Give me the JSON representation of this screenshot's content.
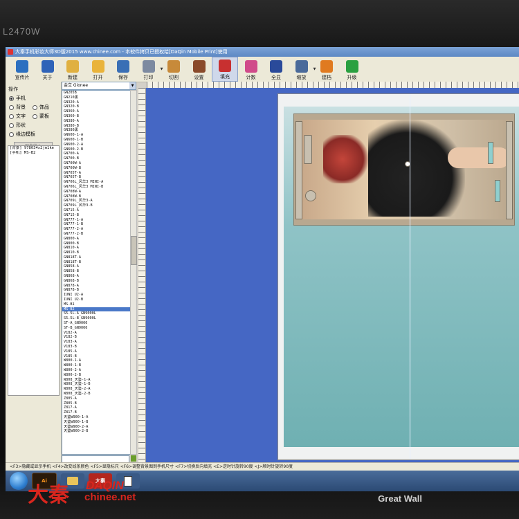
{
  "monitor": {
    "model": "L2470W",
    "brand": "Great Wall"
  },
  "window": {
    "title": "大秦手机彩妆大师3D版2015 www.chinee.com - 本软件拷贝已授权给[DaQin Mobile Print]使用"
  },
  "toolbar": {
    "items": [
      {
        "label": "宣传片",
        "icon": "media-icon",
        "color": "#2b6fc0"
      },
      {
        "label": "关于",
        "icon": "info-icon",
        "color": "#2f63b8"
      },
      {
        "label": "新建",
        "icon": "new-doc-icon",
        "color": "#e0b040"
      },
      {
        "label": "打开",
        "icon": "open-folder-icon",
        "color": "#e9b33a"
      },
      {
        "label": "保存",
        "icon": "save-icon",
        "color": "#3a6fb5"
      },
      {
        "label": "打印",
        "icon": "printer-icon",
        "color": "#7d8aa0"
      },
      {
        "label": "切割",
        "icon": "cut-icon",
        "color": "#c78a3a"
      },
      {
        "label": "设置",
        "icon": "tools-icon",
        "color": "#8a4a2a"
      },
      {
        "label": "填充",
        "icon": "fill-icon",
        "color": "#c83030"
      },
      {
        "label": "计数",
        "icon": "chart-icon",
        "color": "#d04a8a"
      },
      {
        "label": "全显",
        "icon": "fullscreen-icon",
        "color": "#2a4a9a"
      },
      {
        "label": "缩放",
        "icon": "zoom-icon",
        "color": "#4a6a9a"
      },
      {
        "label": "建档",
        "icon": "archive-icon",
        "color": "#e07a20"
      },
      {
        "label": "升级",
        "icon": "upgrade-icon",
        "color": "#2aa040"
      }
    ]
  },
  "left_panel": {
    "group_title": "操作",
    "radios": [
      {
        "label": "手机",
        "checked": true
      },
      {
        "label": "背景",
        "checked": false,
        "pair_label": "饰品"
      },
      {
        "label": "文字",
        "checked": false,
        "pair_label": "蒙板"
      },
      {
        "label": "形状",
        "checked": false
      },
      {
        "label": "缘边模板",
        "checked": false
      }
    ],
    "import_button": "图像输入",
    "layers": [
      "[背景] 978034x2jm1ke",
      "[手机] MS-B2"
    ]
  },
  "model_list": {
    "combo_value": "金立 Gionee",
    "selected_index": 49,
    "items": [
      "GN205B",
      "GN210黑",
      "GN320-A",
      "GN320-B",
      "GN360-A",
      "GN360-B",
      "GN380-A",
      "GN380-B",
      "GN380黑",
      "GN600-1-A",
      "GN600-1-B",
      "GN600-2-A",
      "GN600-2-B",
      "GN700-A",
      "GN700-B",
      "GN700W-A",
      "GN700W-B",
      "GN705T-A",
      "GN705T-B",
      "GN706L_风华3 MINI-A",
      "GN706L_风华3 MINI-B",
      "GN708W-A",
      "GN708W-B",
      "GN709L_风华3-A",
      "GN709L_风华3-B",
      "GN715-A",
      "GN715-B",
      "GN777-1-A",
      "GN777-1-B",
      "GN777-2-A",
      "GN777-2-B",
      "GN800-A",
      "GN800-B",
      "GN810-A",
      "GN810-B",
      "GN818T-A",
      "GN818T-B",
      "GN858-A",
      "GN858-B",
      "GN868-A",
      "GN868-B",
      "GN878-A",
      "GN878-B",
      "IUNI U2-A",
      "IUNI U2-B",
      "MS-B1",
      "MS-B2",
      "S5.5L-A_GN9000L",
      "S5.5L-B_GN9000L",
      "ST-A_GN9006",
      "ST-B_GN9006",
      "V182-A",
      "V182-B",
      "V183-A",
      "V183-B",
      "V185-A",
      "V185-B",
      "W800-1-A",
      "W800-1-B",
      "W800-2-A",
      "W800-2-B",
      "W808_天鉴-1-A",
      "W808_天鉴-1-B",
      "W808_天鉴-2-A",
      "W808_天鉴-2-B",
      "Z805-A",
      "Z805-B",
      "Z817-A",
      "Z817-B",
      "天鉴W900-1-A",
      "天鉴W900-1-B",
      "天鉴W900-2-A",
      "天鉴W900-2-B"
    ]
  },
  "status_bar": "<F3>隐藏或显示手机 <F4>改变线条颜色 <F5>显隐标尺 <F6>调整背景图到手机尺寸 <F7>切换反向填充 <E>逆时针旋转90度 <J>顺时针旋转90度",
  "taskbar": {
    "app_label": "大秦",
    "ai_label": "Ai"
  },
  "watermark": {
    "cn": "大秦",
    "en": "DAQIN",
    "url": "chinee.net"
  }
}
